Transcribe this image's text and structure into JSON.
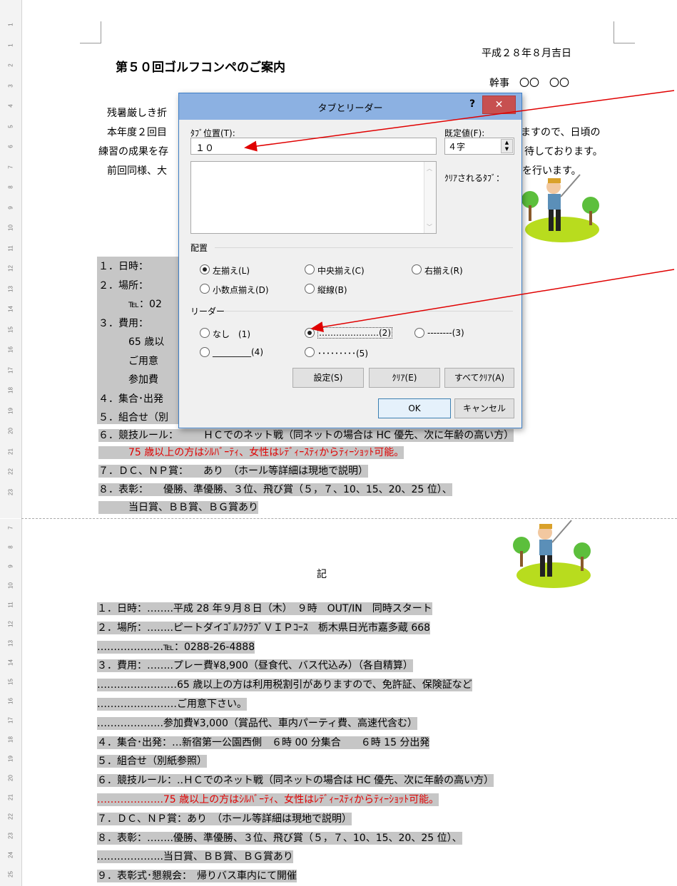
{
  "ruler_top_numbers": [
    "1",
    "1",
    "2",
    "3",
    "4",
    "5",
    "6",
    "7",
    "8",
    "9",
    "10",
    "11",
    "12",
    "13",
    "14",
    "15",
    "16",
    "17",
    "18",
    "19",
    "20",
    "21",
    "22",
    "23"
  ],
  "ruler_bottom_numbers": [
    "7",
    "8",
    "9",
    "10",
    "11",
    "12",
    "13",
    "14",
    "15",
    "16",
    "17",
    "18",
    "19",
    "20",
    "21",
    "22",
    "23",
    "24",
    "25"
  ],
  "document_top": {
    "date": "平成２８年８月吉日",
    "title": "第５０回ゴルフコンペのご案内",
    "organizer": "幹事　〇〇　〇〇",
    "para1": "残暑厳しき折",
    "para2a": "本年度２回目",
    "para2b": "ますので、日頃の",
    "para3a": "練習の成果を存",
    "para3b": "待しております。",
    "para4a": "前回同様、大",
    "para4b": "を行います。",
    "items": [
      "１．日時：",
      "２．場所：",
      "　　　℡：02",
      "３．費用：",
      "　　　65 歳以",
      "　　　ご用意",
      "　　　参加費",
      "４．集合･出発",
      "５．組合せ（別"
    ],
    "item6": "６．競技ルール：　　　ＨＣでのネット戦（同ネットの場合は HC 優先、次に年齢の高い方）",
    "item6_red": "　　　75 歳以上の方はｼﾙﾊﾞｰﾃｨ、女性はﾚﾃﾞｨｰｽﾃｨからﾃｨｰｼｮｯﾄ可能。",
    "item7": "７．ＤＣ、ＮＰ賞：　　あり　（ホール等詳細は現地で説明）",
    "item8": "８．表彰：　　優勝、準優勝、３位、飛び賞（５，７、10、15、20、25 位）、",
    "item8b": "　　　当日賞、ＢＢ賞、ＢＧ賞あり"
  },
  "document_bottom": {
    "ki": "記",
    "lines": [
      "１．日時：……..平成 28 年９月８日（木）　９時　OUT/IN　同時スタート",
      "２．場所：……..ピートダイｺﾞﾙﾌｸﾗﾌﾞＶＩＰｺｰｽ　栃木県日光市嘉多蔵 668",
      "………………..℡：0288-26-4888",
      "３．費用：……..プレー費¥8,900（昼食代、バス代込み）（各自精算）",
      "……………………65 歳以上の方は利用税割引がありますので、免許証、保険証など",
      "……………………ご用意下さい。",
      "………………..参加費¥3,000（賞品代、車内パーティ費、高速代含む）",
      "４．集合･出発：…新宿第一公園西側　６時 00 分集合　　６時 15 分出発",
      "５．組合せ（別紙参照）",
      "６．競技ルール：..ＨＣでのネット戦（同ネットの場合は HC 優先、次に年齢の高い方）",
      "………………..75 歳以上の方はｼﾙﾊﾞｰﾃｨ、女性はﾚﾃﾞｨｰｽﾃｨからﾃｨｰｼｮｯﾄ可能。",
      "７．ＤＣ、ＮＰ賞：あり　（ホール等詳細は現地で説明）",
      "８．表彰：……..優勝、準優勝、３位、飛び賞（５，７、10、15、20、25 位）、",
      "………………..当日賞、ＢＢ賞、ＢＧ賞あり",
      "９．表彰式･懇親会：　帰りバス車内にて開催"
    ]
  },
  "dialog": {
    "title": "タブとリーダー",
    "help": "?",
    "close": "✕",
    "tab_position_label": "ﾀﾌﾞ位置(T):",
    "tab_position_value": "１０",
    "default_label": "既定値(F):",
    "default_value": "４字",
    "clear_label": "ｸﾘｱされるﾀﾌﾞ：",
    "alignment_label": "配置",
    "align_left": "左揃え(L)",
    "align_center": "中央揃え(C)",
    "align_right": "右揃え(R)",
    "align_decimal": "小数点揃え(D)",
    "align_bar": "縦線(B)",
    "leader_label": "リーダー",
    "leader_none": "なし　(1)",
    "leader_2": "…………………(2)",
    "leader_3": "--------(3)",
    "leader_4": "_________(4)",
    "leader_5": "･････････(5)",
    "set_button": "設定(S)",
    "clear_button": "ｸﾘｱ(E)",
    "clear_all_button": "すべてｸﾘｱ(A)",
    "ok_button": "OK",
    "cancel_button": "キャンセル"
  },
  "colors": {
    "accent_red": "#e00000",
    "title_bar": "#8cb1e2",
    "close_button": "#c75050",
    "highlight": "#c6c6c6"
  }
}
